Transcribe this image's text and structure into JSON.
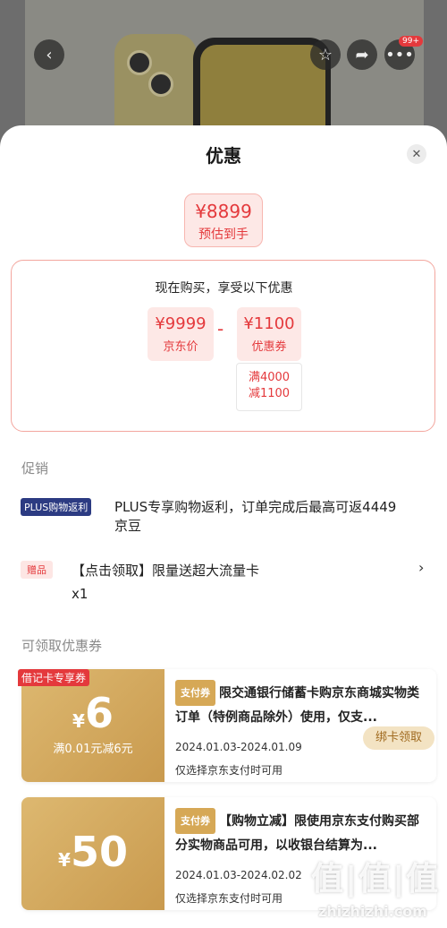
{
  "header": {
    "notification_badge": "99+",
    "icons": [
      "back-icon",
      "star-icon",
      "share-icon",
      "more-icon"
    ]
  },
  "sheet": {
    "title": "优惠",
    "estimate": {
      "price": "¥8899",
      "label": "预估到手"
    },
    "calc": {
      "lead": "现在购买，享受以下优惠",
      "jd_price": {
        "value": "¥9999",
        "label": "京东价"
      },
      "minus": "-",
      "coupon": {
        "value": "¥1100",
        "label": "优惠券"
      },
      "condition_line1": "满4000",
      "condition_line2": "减1100"
    },
    "promo": {
      "section_title": "促销",
      "plus_tag": "PLUS购物返利",
      "plus_text": "PLUS专享购物返利，订单完成后最高可返4449京豆",
      "gift_tag": "赠品",
      "gift_text": "【点击领取】限量送超大流量卡",
      "gift_qty": "x1"
    },
    "coupons": {
      "section_title": "可领取优惠券",
      "items": [
        {
          "corner_tag": "借记卡专享券",
          "yen": "¥",
          "amount": "6",
          "condition": "满0.01元减6元",
          "type_tag": "支付券",
          "description": "限交通银行储蓄卡购京东商城实物类订单（特例商品除外）使用，仅支...",
          "date": "2024.01.03-2024.01.09",
          "note": "仅选择京东支付时可用",
          "button": "绑卡领取"
        },
        {
          "yen": "¥",
          "amount": "50",
          "type_tag": "支付券",
          "description": "【购物立减】限使用京东支付购买部分实物商品可用，以收银台结算为...",
          "date": "2024.01.03-2024.02.02",
          "note": "仅选择京东支付时可用"
        }
      ]
    }
  },
  "watermark": {
    "text": "值|值|值",
    "url": "zhizhizhi.com"
  },
  "colors": {
    "accent": "#e4393c",
    "gold": "#d6a856",
    "plus_blue": "#2c3b82"
  }
}
